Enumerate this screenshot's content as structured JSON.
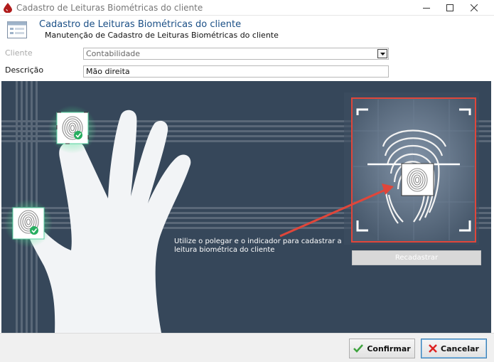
{
  "window": {
    "title": "Cadastro de Leituras Biométricas do cliente"
  },
  "header": {
    "title": "Cadastro de Leituras Biométricas do cliente",
    "subtitle": "Manutenção de Cadastro de Leituras Biométricas do cliente"
  },
  "form": {
    "cliente_label": "Cliente",
    "cliente_value": "Contabilidade",
    "descricao_label": "Descrição",
    "descricao_value": "Mão direita"
  },
  "scan": {
    "instruction": "Utilize o polegar e o indicador para cadastrar a leitura biométrica do cliente",
    "recadastrar_label": "Recadastrar",
    "captured_fingers": [
      "index",
      "thumb"
    ]
  },
  "footer": {
    "confirm_label": "Confirmar",
    "cancel_label": "Cancelar"
  },
  "colors": {
    "panel_bg": "#36475a",
    "accent_red": "#e0463a",
    "check_green": "#27ae60",
    "header_blue": "#1a4f86"
  },
  "icons": {
    "app": "blood-drop-icon",
    "header": "form-list-icon",
    "confirm": "check-icon",
    "cancel": "x-icon"
  }
}
